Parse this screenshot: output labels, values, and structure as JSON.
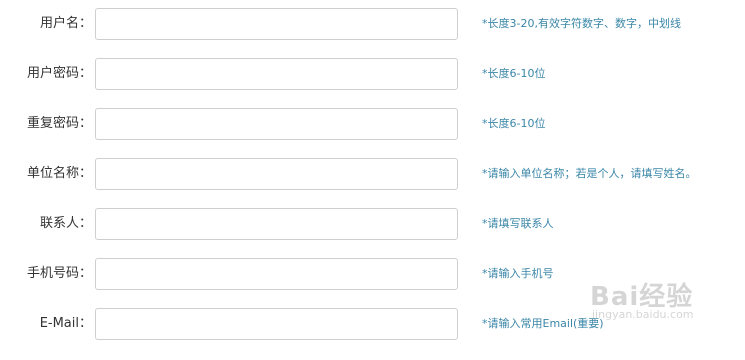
{
  "form": {
    "rows": [
      {
        "label": "用户名：",
        "value": "",
        "hint": "*长度3-20,有效字符数字、数字，中划线"
      },
      {
        "label": "用户密码：",
        "value": "",
        "hint": "*长度6-10位"
      },
      {
        "label": "重复密码：",
        "value": "",
        "hint": "*长度6-10位"
      },
      {
        "label": "单位名称：",
        "value": "",
        "hint": "*请输入单位名称；若是个人，请填写姓名。"
      },
      {
        "label": "联系人：",
        "value": "",
        "hint": "*请填写联系人"
      },
      {
        "label": "手机号码：",
        "value": "",
        "hint": "*请输入手机号"
      },
      {
        "label": "E-Mail：",
        "value": "",
        "hint": "*请输入常用Email(重要)"
      }
    ]
  },
  "watermark": {
    "text": "Bai经验",
    "url": "jingyan.baidu.com"
  },
  "colors": {
    "hint": "#3a86a8",
    "label": "#333333",
    "border": "#cfcfcf"
  }
}
